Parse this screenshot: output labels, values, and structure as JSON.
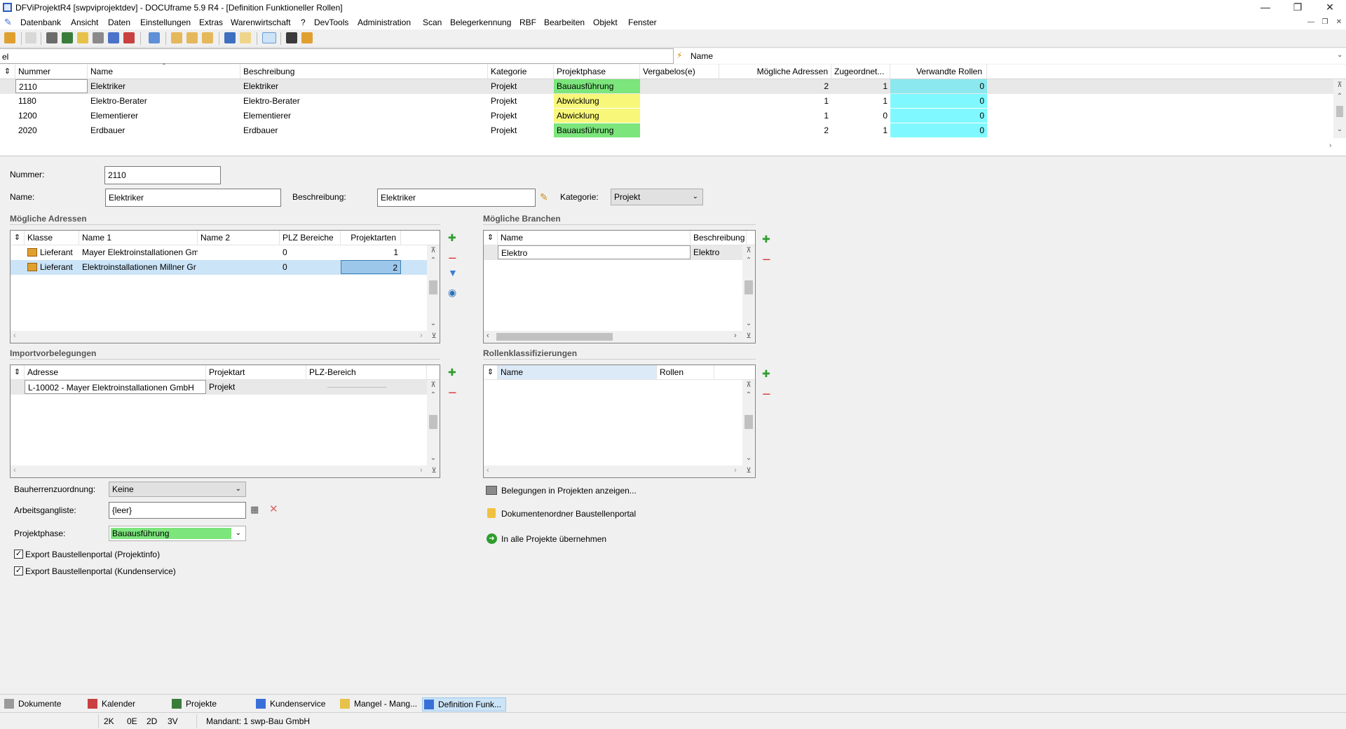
{
  "window": {
    "title": "DFViProjektR4 [swpviprojektdev] - DOCUframe 5.9 R4 - [Definition Funktioneller Rollen]"
  },
  "menu": [
    "Datenbank",
    "Ansicht",
    "Daten",
    "Einstellungen",
    "Extras",
    "Warenwirtschaft",
    "?",
    "DevTools",
    "Administration",
    "Scan",
    "Belegerkennung",
    "RBF",
    "Bearbeiten",
    "Objekt",
    "Fenster"
  ],
  "filter": {
    "value": "el",
    "search_label": "Name"
  },
  "colors": {
    "green": "#7ce57c",
    "yellow": "#f8f77a",
    "cyan": "#7ff9ff",
    "cyan_selected": "#8ae8ee",
    "selection": "#cce4f7"
  },
  "grid": {
    "headers": [
      "Nummer",
      "Name",
      "Beschreibung",
      "Kategorie",
      "Projektphase",
      "Vergabelos(e)",
      "Mögliche Adressen",
      "Zugeordnet...",
      "Verwandte Rollen"
    ],
    "rows": [
      {
        "nummer": "2110",
        "name": "Elektriker",
        "beschreibung": "Elektriker",
        "kategorie": "Projekt",
        "phase": "Bauausführung",
        "phase_color": "green",
        "vergabe": "",
        "adressen": "2",
        "zugeordnet": "1",
        "verwandt": "0"
      },
      {
        "nummer": "1180",
        "name": "Elektro-Berater",
        "beschreibung": "Elektro-Berater",
        "kategorie": "Projekt",
        "phase": "Abwicklung",
        "phase_color": "yellow",
        "vergabe": "",
        "adressen": "1",
        "zugeordnet": "1",
        "verwandt": "0"
      },
      {
        "nummer": "1200",
        "name": "Elementierer",
        "beschreibung": "Elementierer",
        "kategorie": "Projekt",
        "phase": "Abwicklung",
        "phase_color": "yellow",
        "vergabe": "",
        "adressen": "1",
        "zugeordnet": "0",
        "verwandt": "0"
      },
      {
        "nummer": "2020",
        "name": "Erdbauer",
        "beschreibung": "Erdbauer",
        "kategorie": "Projekt",
        "phase": "Bauausführung",
        "phase_color": "green",
        "vergabe": "",
        "adressen": "2",
        "zugeordnet": "1",
        "verwandt": "0"
      }
    ]
  },
  "form": {
    "nummer_label": "Nummer:",
    "nummer": "2110",
    "name_label": "Name:",
    "name": "Elektriker",
    "beschreibung_label": "Beschreibung:",
    "beschreibung": "Elektriker",
    "kategorie_label": "Kategorie:",
    "kategorie": "Projekt"
  },
  "adressen": {
    "title": "Mögliche Adressen",
    "headers": [
      "Klasse",
      "Name 1",
      "Name 2",
      "PLZ Bereiche",
      "Projektarten"
    ],
    "rows": [
      {
        "klasse": "Lieferant",
        "name1": "Mayer Elektroinstallationen Gm",
        "name2": "",
        "plz": "0",
        "projektarten": "1"
      },
      {
        "klasse": "Lieferant",
        "name1": "Elektroinstallationen Millner Gr",
        "name2": "",
        "plz": "0",
        "projektarten": "2"
      }
    ]
  },
  "branchen": {
    "title": "Mögliche Branchen",
    "headers": [
      "Name",
      "Beschreibung"
    ],
    "rows": [
      {
        "name": "Elektro",
        "beschreibung": "Elektro"
      }
    ]
  },
  "import": {
    "title": "Importvorbelegungen",
    "headers": [
      "Adresse",
      "Projektart",
      "PLZ-Bereich"
    ],
    "rows": [
      {
        "adresse": "L-10002 - Mayer Elektroinstallationen GmbH",
        "projektart": "Projekt",
        "plz": ""
      }
    ]
  },
  "klassifizierungen": {
    "title": "Rollenklassifizierungen",
    "headers": [
      "Name",
      "Rollen"
    ]
  },
  "bottom": {
    "bauherr_label": "Bauherrenzuordnung:",
    "bauherr": "Keine",
    "arbeitsgang_label": "Arbeitsgangliste:",
    "arbeitsgang": "{leer}",
    "phase_label": "Projektphase:",
    "phase": "Bauausführung",
    "export1": "Export Baustellenportal (Projektinfo)",
    "export2": "Export Baustellenportal (Kundenservice)"
  },
  "actions": {
    "belegungen": "Belegungen in Projekten anzeigen...",
    "dokumentenordner": "Dokumentenordner Baustellenportal",
    "uebernehmen": "In alle Projekte übernehmen"
  },
  "tasks": [
    "Dokumente",
    "Kalender",
    "Projekte",
    "Kundenservice",
    "Mangel - Mang...",
    "Definition Funk..."
  ],
  "status": {
    "k": "2K",
    "e": "0E",
    "d": "2D",
    "v": "3V",
    "mandant": "Mandant: 1 swp-Bau GmbH"
  }
}
